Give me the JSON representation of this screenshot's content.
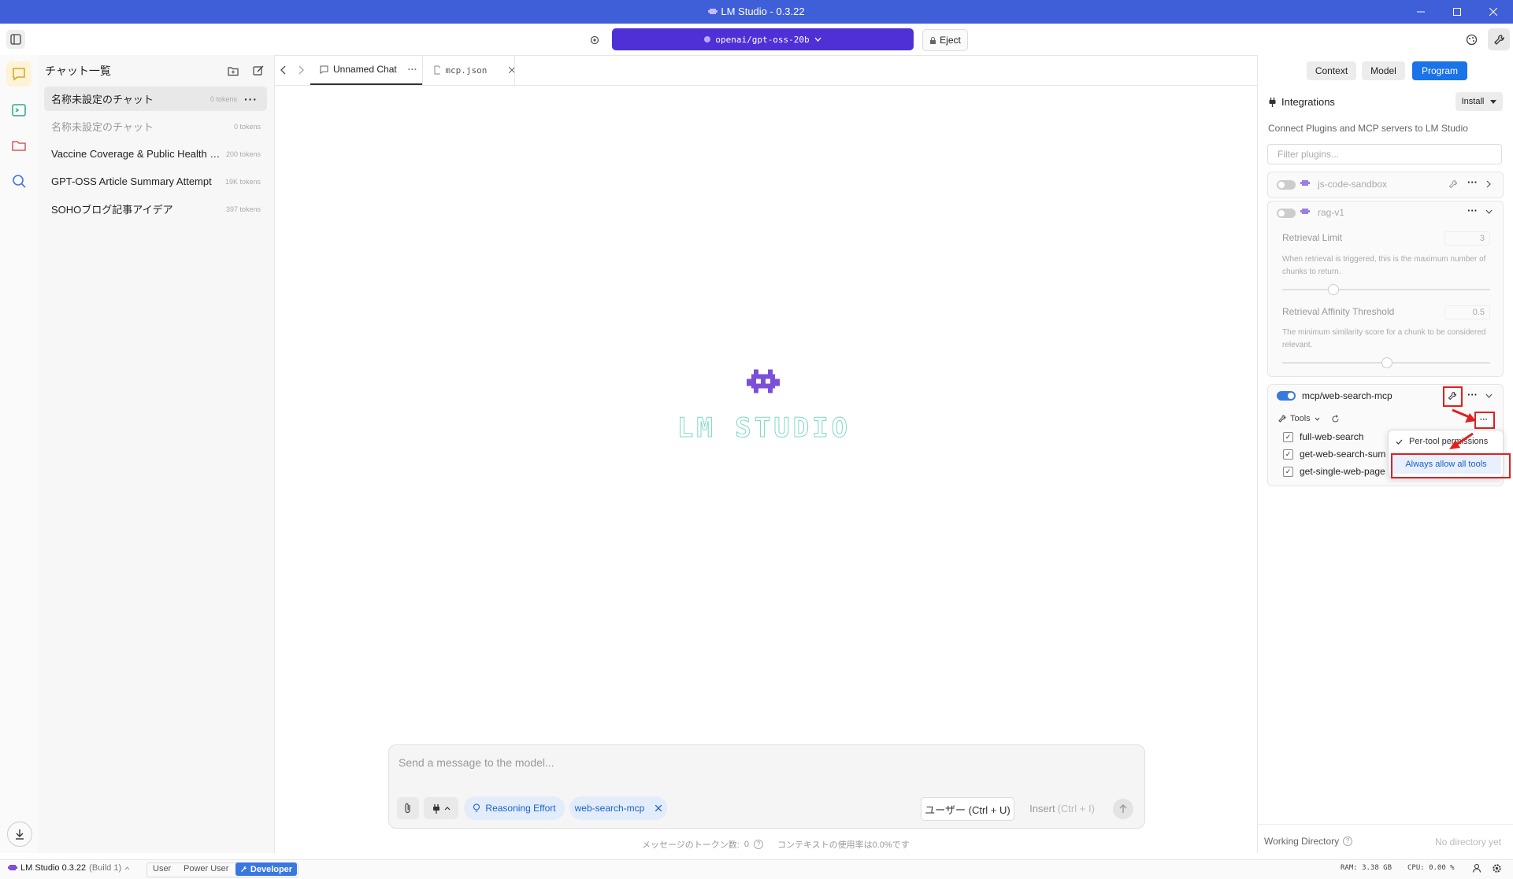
{
  "window": {
    "title": "LM Studio - 0.3.22"
  },
  "toolbar": {
    "model_name": "openai/gpt-oss-20b",
    "eject_label": "Eject"
  },
  "chatlist": {
    "header": "チャット一覧",
    "items": [
      {
        "name": "名称未設定のチャット",
        "tokens": "0 tokens"
      },
      {
        "name": "名称未設定のチャット",
        "tokens": "0 tokens"
      },
      {
        "name": "Vaccine Coverage & Public Health M...",
        "tokens": "200 tokens"
      },
      {
        "name": "GPT-OSS Article Summary Attempt",
        "tokens": "19K tokens"
      },
      {
        "name": "SOHOブログ記事アイデア",
        "tokens": "397 tokens"
      }
    ]
  },
  "tabs": [
    {
      "label": "Unnamed Chat"
    },
    {
      "label": "mcp.json"
    }
  ],
  "main": {
    "logo_text": "LM STUDIO",
    "composer_placeholder": "Send a message to the model...",
    "reasoning_label": "Reasoning Effort",
    "mcp_chip": "web-search-mcp",
    "user_button": "ユーザー (Ctrl + U)",
    "insert_label": "Insert",
    "insert_shortcut": "(Ctrl + I)",
    "token_count_label": "メッセージのトークン数:",
    "token_count_value": "0",
    "context_usage": "コンテキストの使用率は0.0%です"
  },
  "right_panel": {
    "tabs": [
      "Context",
      "Model",
      "Program"
    ],
    "integrations_title": "Integrations",
    "install_label": "Install",
    "description": "Connect Plugins and MCP servers to LM Studio",
    "filter_placeholder": "Filter plugins...",
    "plugins": [
      {
        "name": "js-code-sandbox",
        "enabled": false
      },
      {
        "name": "rag-v1",
        "enabled": false
      },
      {
        "name": "mcp/web-search-mcp",
        "enabled": true
      }
    ],
    "rag": {
      "retrieval_limit_label": "Retrieval Limit",
      "retrieval_limit_value": "3",
      "retrieval_limit_desc": "When retrieval is triggered, this is the maximum number of chunks to return.",
      "affinity_label": "Retrieval Affinity Threshold",
      "affinity_value": "0.5",
      "affinity_desc": "The minimum similarity score for a chunk to be considered relevant."
    },
    "tools_label": "Tools",
    "tools": [
      "full-web-search",
      "get-web-search-sum",
      "get-single-web-page"
    ],
    "menu": {
      "option1": "Per-tool permissions",
      "option2": "Always allow all tools"
    },
    "working_directory_label": "Working Directory",
    "working_directory_value": "No directory yet"
  },
  "statusbar": {
    "app_version": "LM Studio 0.3.22",
    "build": "(Build 1)",
    "modes": [
      "User",
      "Power User",
      "Developer"
    ],
    "ram": "RAM: 3.38 GB",
    "cpu": "CPU: 0.00 %"
  },
  "colors": {
    "titlebar": "#3f5fd8",
    "model_select": "#4f2fd6",
    "accent": "#1a73e8",
    "highlight": "#e02020"
  }
}
